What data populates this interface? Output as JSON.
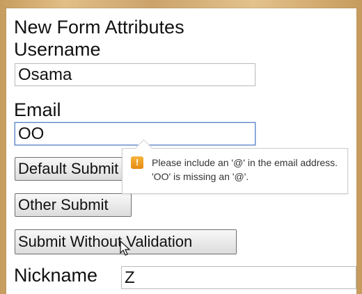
{
  "form": {
    "title": "New Form Attributes",
    "username_label": "Username",
    "username_value": "Osama",
    "email_label": "Email",
    "email_value": "OO",
    "nickname_label": "Nickname",
    "nickname_value": "Z"
  },
  "buttons": {
    "default_submit": "Default Submit",
    "other_submit": "Other Submit",
    "submit_without_validation": "Submit Without Validation"
  },
  "validation": {
    "message": "Please include an '@' in the email address. 'OO' is missing an '@'.",
    "icon": "warning-icon",
    "icon_color": "#f0a020"
  }
}
